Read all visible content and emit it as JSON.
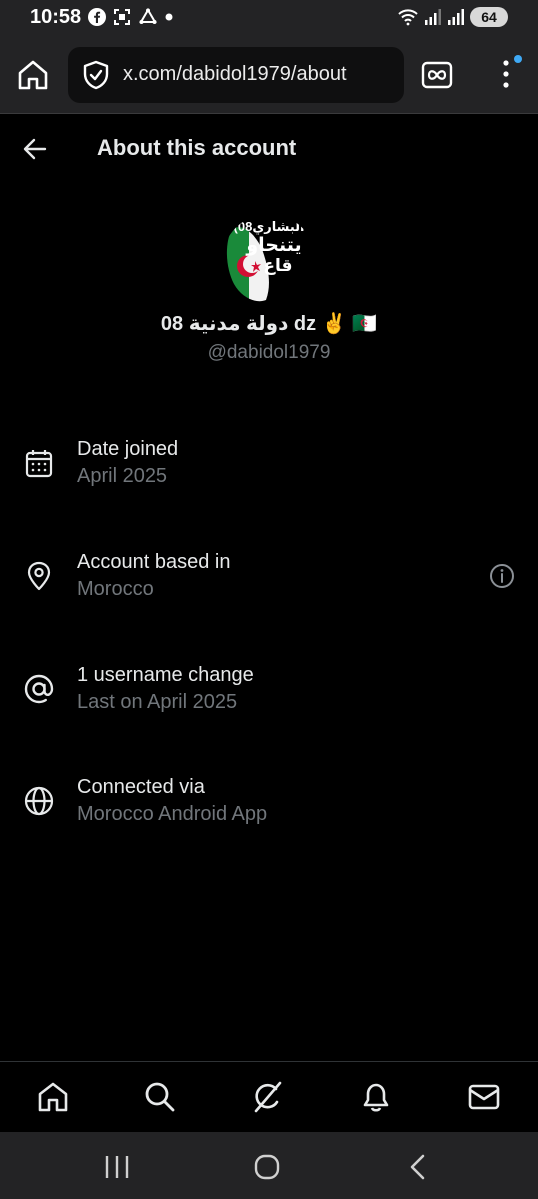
{
  "status_bar": {
    "time": "10:58",
    "battery": "64"
  },
  "browser": {
    "url": "x.com/dabidol1979/about"
  },
  "header": {
    "title": "About this account"
  },
  "profile": {
    "avatar_text": [
      "(البشاري08",
      "يتنحاو",
      "قاع"
    ],
    "display_name": "08 دولة مدنية dz ✌️ 🇩🇿",
    "handle": "@dabidol1979"
  },
  "info": {
    "date_joined": {
      "title": "Date joined",
      "value": "April 2025"
    },
    "account_based": {
      "title": "Account based in",
      "value": "Morocco"
    },
    "username_change": {
      "title": "1 username change",
      "value": "Last on April 2025"
    },
    "connected_via": {
      "title": "Connected via",
      "value": "Morocco Android App"
    }
  },
  "colors": {
    "background": "#000000",
    "primary_text": "#e7e9ea",
    "secondary_text": "#71767b",
    "chrome_bar": "#232325",
    "accent_dot": "#3fa9f5"
  },
  "icons": {
    "status_left": [
      "facebook-icon",
      "screenshot-icon",
      "sync-icon",
      "dot-icon"
    ],
    "status_right": [
      "wifi-icon",
      "signal-icon",
      "signal-icon",
      "battery-icon"
    ],
    "tabs": [
      "home-icon",
      "search-icon",
      "grok-icon",
      "notifications-icon",
      "messages-icon"
    ],
    "nav": [
      "recents-icon",
      "home-circle-icon",
      "back-chevron-icon"
    ]
  }
}
